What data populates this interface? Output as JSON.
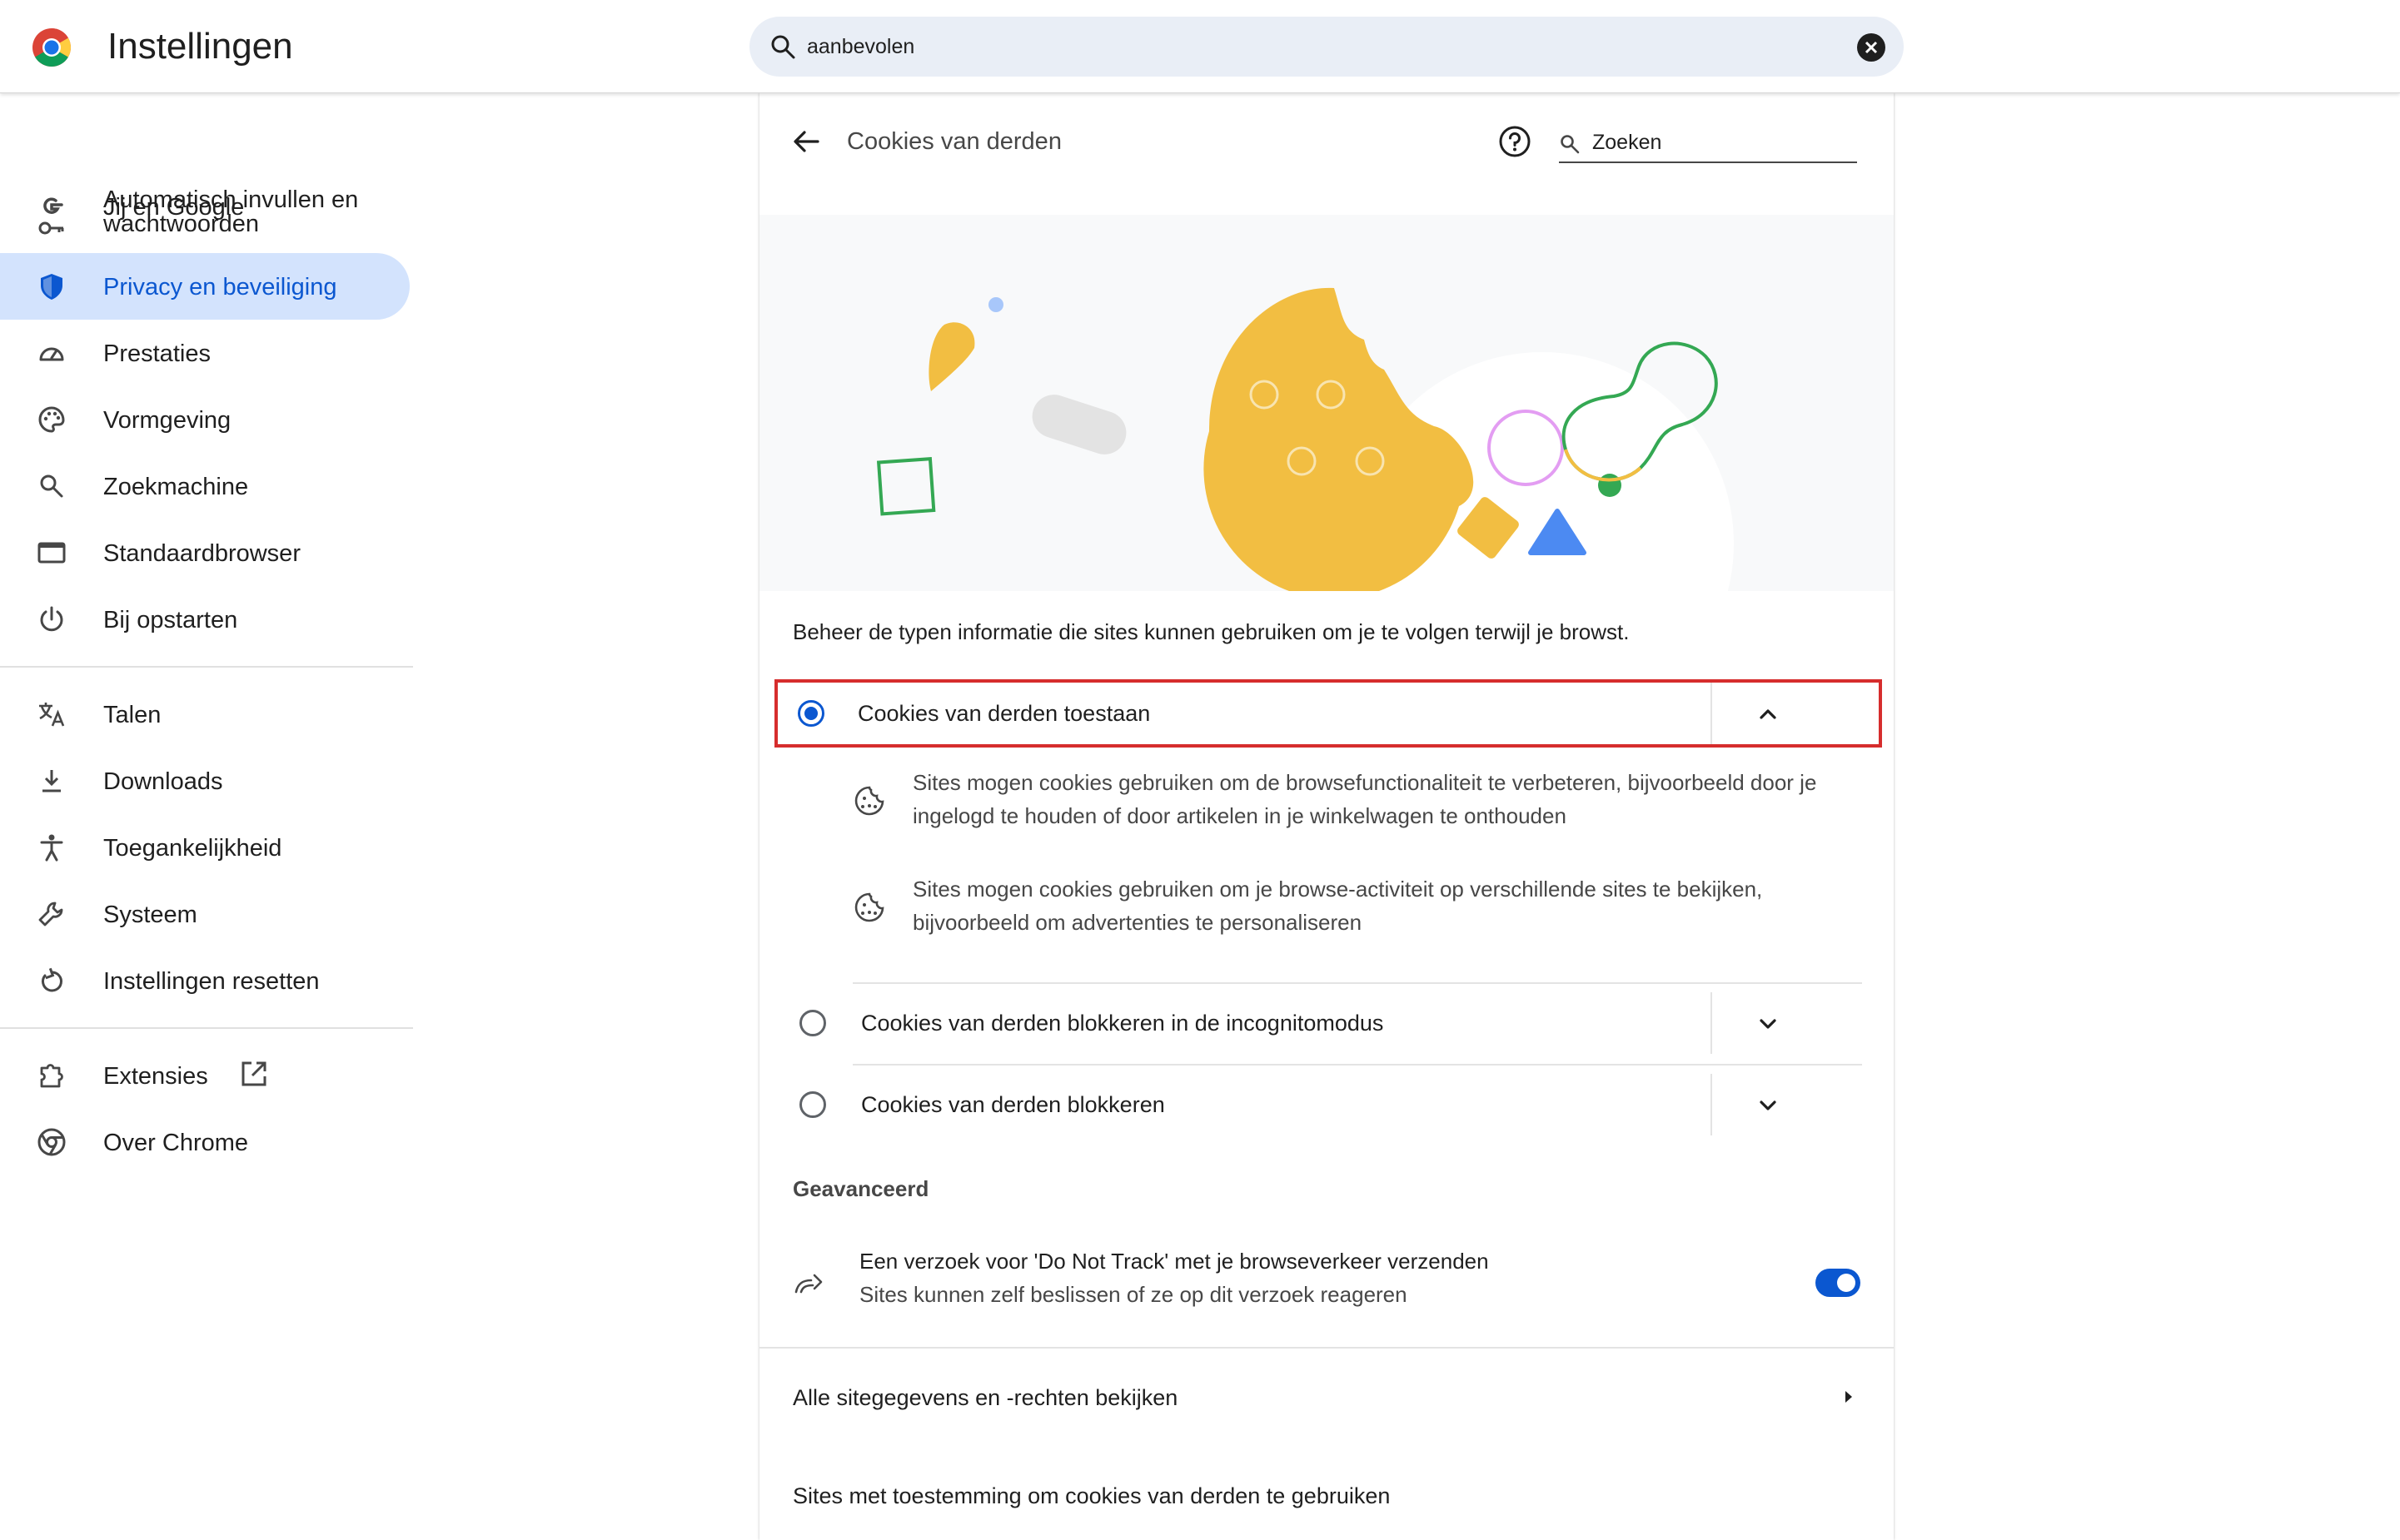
{
  "app": {
    "title": "Instellingen"
  },
  "search": {
    "value": "aanbevolen"
  },
  "sidebar": {
    "items": [
      {
        "label": "Jij en Google",
        "icon": "google-g-icon"
      },
      {
        "label": "Automatisch invullen en wachtwoorden",
        "icon": "key-icon"
      },
      {
        "label": "Privacy en beveiliging",
        "icon": "shield-icon",
        "active": true
      },
      {
        "label": "Prestaties",
        "icon": "speedometer-icon"
      },
      {
        "label": "Vormgeving",
        "icon": "palette-icon"
      },
      {
        "label": "Zoekmachine",
        "icon": "search-icon"
      },
      {
        "label": "Standaardbrowser",
        "icon": "browser-window-icon"
      },
      {
        "label": "Bij opstarten",
        "icon": "power-icon"
      },
      {
        "label": "Talen",
        "icon": "translate-icon"
      },
      {
        "label": "Downloads",
        "icon": "download-icon"
      },
      {
        "label": "Toegankelijkheid",
        "icon": "accessibility-icon"
      },
      {
        "label": "Systeem",
        "icon": "wrench-icon"
      },
      {
        "label": "Instellingen resetten",
        "icon": "reset-icon"
      },
      {
        "label": "Extensies",
        "icon": "puzzle-icon"
      },
      {
        "label": "Over Chrome",
        "icon": "chrome-icon"
      }
    ]
  },
  "page": {
    "title": "Cookies van derden",
    "search_placeholder": "Zoeken",
    "description": "Beheer de typen informatie die sites kunnen gebruiken om je te volgen terwijl je browst.",
    "options": [
      {
        "label": "Cookies van derden toestaan",
        "checked": true,
        "expanded": true
      },
      {
        "label": "Cookies van derden blokkeren in de incognitomodus",
        "checked": false,
        "expanded": false
      },
      {
        "label": "Cookies van derden blokkeren",
        "checked": false,
        "expanded": false
      }
    ],
    "details": [
      {
        "text": "Sites mogen cookies gebruiken om de browsefunctionaliteit te verbeteren, bijvoorbeeld door je ingelogd te houden of door artikelen in je winkelwagen te onthouden"
      },
      {
        "text": "Sites mogen cookies gebruiken om je browse-activiteit op verschillende sites te bekijken, bijvoorbeeld om advertenties te personaliseren"
      }
    ],
    "advanced": {
      "title": "Geavanceerd",
      "dnt_title": "Een verzoek voor 'Do Not Track' met je browseverkeer verzenden",
      "dnt_subtitle": "Sites kunnen zelf beslissen of ze op dit verzoek reageren",
      "dnt_enabled": true
    },
    "site_data_link": "Alle sitegegevens en -rechten bekijken",
    "allowed_sites_title": "Sites met toestemming om cookies van derden te gebruiken"
  },
  "colors": {
    "accent": "#0b57d0",
    "active_nav_bg": "#d3e3fd",
    "highlight_border": "#d62d2d",
    "cookie_yellow": "#f2be42"
  }
}
